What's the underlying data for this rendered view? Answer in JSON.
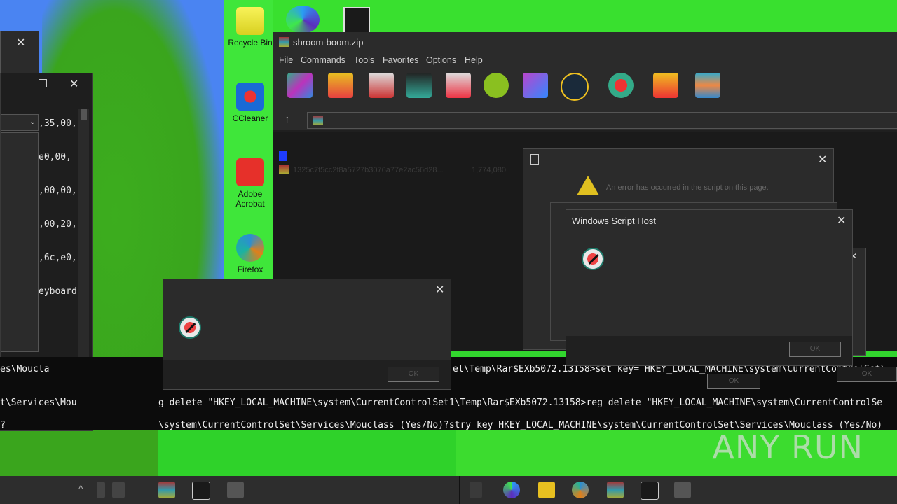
{
  "desktop": {
    "icons": [
      {
        "label": "Recycle Bin"
      },
      {
        "label": "CCleaner"
      },
      {
        "label": "Adobe Acrobat"
      },
      {
        "label": "Firefox"
      }
    ]
  },
  "regedit": {
    "lines": [
      ",35,00,",
      "e0,00,",
      ",00,00,",
      ",00,20,",
      ",6c,e0,",
      "eyboard"
    ]
  },
  "winrar": {
    "title": "shroom-boom.zip",
    "menu": [
      "File",
      "Commands",
      "Tools",
      "Favorites",
      "Options",
      "Help"
    ],
    "file_row": {
      "name": "1325c7f5cc2f8a5727b3076a77e2ac56d28...",
      "size": "1,774,080"
    }
  },
  "dialog_warning": {
    "message": "An error has occurred in the script on this page."
  },
  "dialog_wsh": {
    "title": "Windows Script Host",
    "ok_label": "OK"
  },
  "dialog_error": {
    "ok_label": "OK"
  },
  "console": {
    "lines": [
      "es\\Moucla",
      "t\\Services\\Mou",
      "g delete \"HKEY_LOCAL_MACHINE\\system\\CurrentControlSet1\\Temp\\Rar$EXb5072.13158>reg delete \"HKEY_LOCAL_MACHINE\\system\\CurrentControlSe",
      "\\system\\CurrentControlSet\\Services\\Mouclass (Yes/No)?stry key HKEY_LOCAL_MACHINE\\system\\CurrentControlSet\\Services\\Mouclass (Yes/No)",
      "el\\Temp\\Rar$EXb5072.13158>set key= HKEY_LOCAL_MACHINE\\system\\CurrentControlSet\\",
      "?"
    ]
  },
  "watermark": "ANY RUN"
}
